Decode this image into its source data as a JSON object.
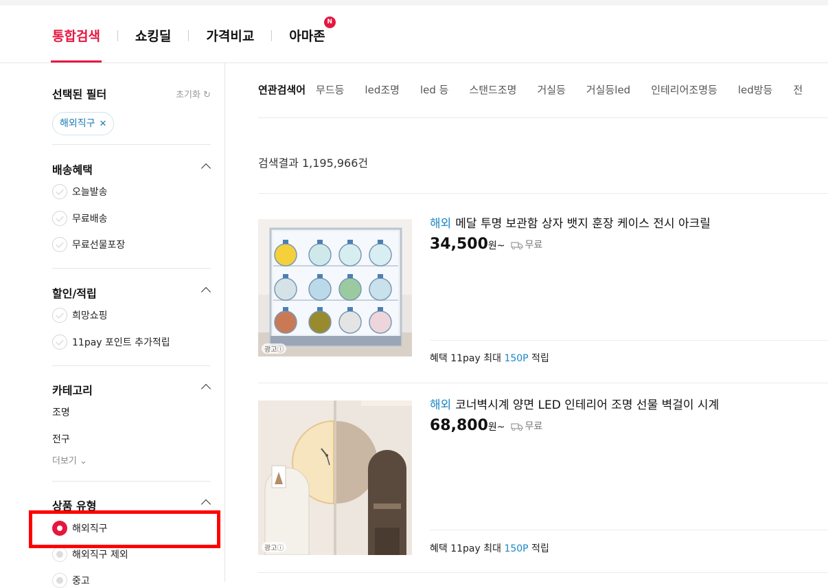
{
  "tabs": [
    {
      "label": "통합검색"
    },
    {
      "label": "쇼킹딜"
    },
    {
      "label": "가격비교"
    },
    {
      "label": "아마존",
      "badge": "N"
    }
  ],
  "sidebar": {
    "selected_title": "선택된 필터",
    "reset_label": "초기화",
    "selected_chip": "해외직구",
    "shipping": {
      "title": "배송혜택",
      "items": [
        "오늘발송",
        "무료배송",
        "무료선물포장"
      ]
    },
    "discount": {
      "title": "할인/적립",
      "items": [
        "희망쇼핑",
        "11pay 포인트 추가적립"
      ]
    },
    "category": {
      "title": "카테고리",
      "items": [
        "조명",
        "전구"
      ],
      "more": "더보기"
    },
    "product_type": {
      "title": "상품 유형",
      "items": [
        "해외직구",
        "해외직구 제외",
        "중고"
      ]
    }
  },
  "main": {
    "related_label": "연관검색어",
    "related_keywords": [
      "무드등",
      "led조명",
      "led 등",
      "스탠드조명",
      "거실등",
      "거실등led",
      "인테리어조명등",
      "led방등",
      "전"
    ],
    "result_count": "검색결과 1,195,966건",
    "products": [
      {
        "tag": "해외",
        "title": "메달 투명 보관함 상자 뱃지 훈장 케이스 전시 아크릴",
        "price": "34,500",
        "unit": "원~",
        "shipping": "무료",
        "benefit_prefix": "혜택  11pay 최대 ",
        "benefit_point": "150P",
        "benefit_suffix": " 적립",
        "ad": "광고"
      },
      {
        "tag": "해외",
        "title": "코너벽시계 양면 LED 인테리어 조명 선물 벽걸이 시계",
        "price": "68,800",
        "unit": "원~",
        "shipping": "무료",
        "benefit_prefix": "혜택  11pay 최대 ",
        "benefit_point": "150P",
        "benefit_suffix": " 적립",
        "ad": "광고"
      }
    ]
  },
  "colors": {
    "accent": "#e5173f",
    "link": "#1a87c9",
    "highlight": "#ff0000"
  }
}
